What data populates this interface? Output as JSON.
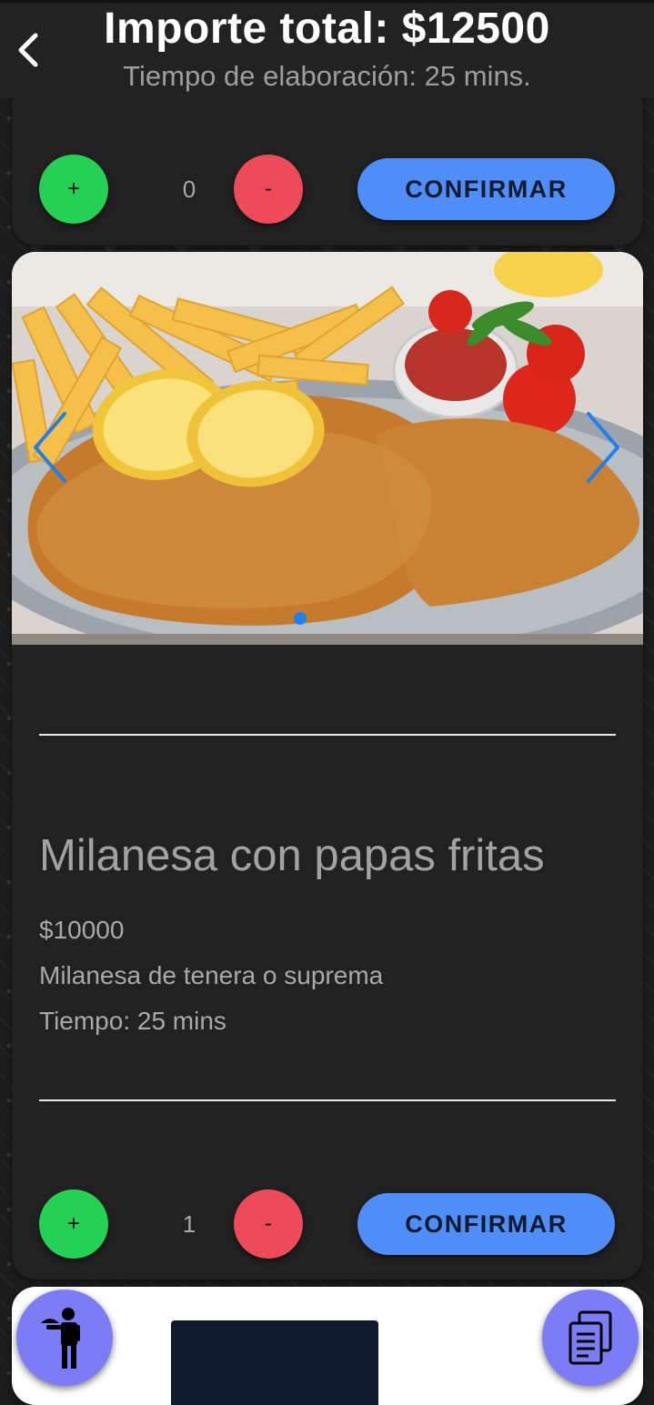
{
  "header": {
    "title": "Importe total: $12500",
    "subtitle": "Tiempo de elaboración: 25 mins.",
    "back_icon": "back-chevron-icon"
  },
  "top_card": {
    "quantity": "0",
    "plus_label": "+",
    "minus_label": "-",
    "confirm_label": "CONFIRMAR"
  },
  "product": {
    "name": "Milanesa con papas fritas",
    "price": "$10000",
    "description": "Milanesa de tenera o suprema",
    "time": "Tiempo: 25 mins",
    "quantity": "1",
    "plus_label": "+",
    "minus_label": "-",
    "confirm_label": "CONFIRMAR",
    "carousel": {
      "active_index": 0,
      "prev_icon": "chevron-left-icon",
      "next_icon": "chevron-right-icon"
    }
  },
  "fabs": {
    "left_icon": "waiter-icon",
    "right_icon": "order-list-icon"
  },
  "colors": {
    "plus": "#25d155",
    "minus": "#ee4b5a",
    "confirm": "#4f8ef9",
    "fab": "#7b7cf6",
    "carousel_arrow": "#1e7ff0"
  }
}
